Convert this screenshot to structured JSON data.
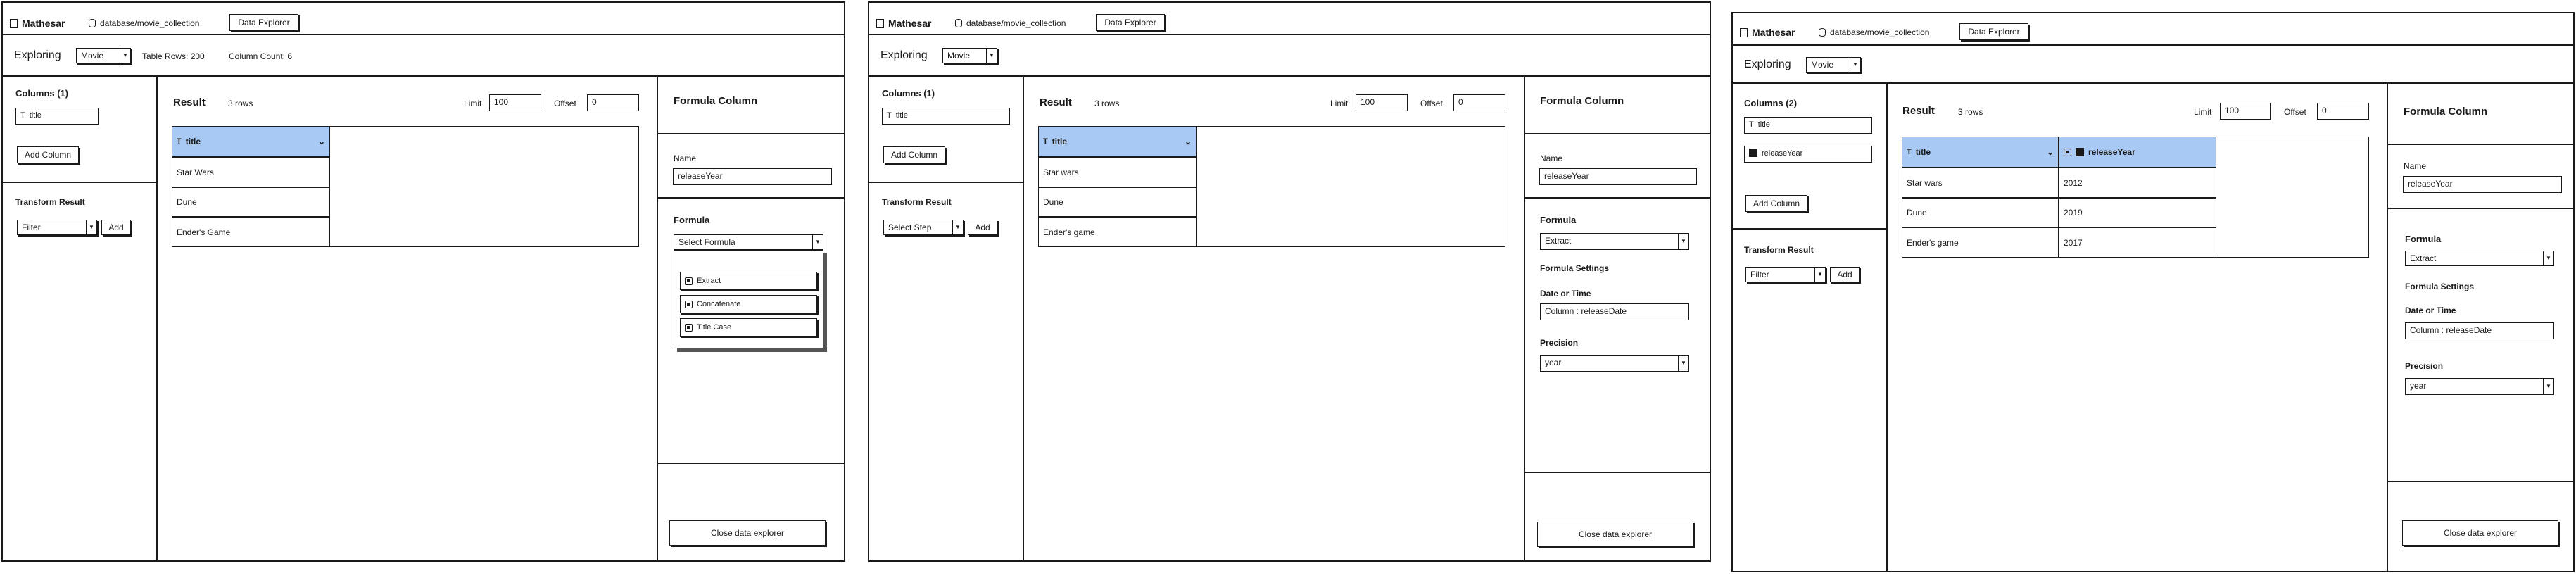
{
  "frames": [
    {
      "app": {
        "logo": "Mathesar",
        "breadcrumb": "database/movie_collection",
        "tab": "Data Explorer"
      },
      "explore": {
        "label": "Exploring",
        "table": "Movie",
        "table_rows": "Table Rows: 200",
        "column_count": "Column Count: 6"
      },
      "left": {
        "columns_heading": "Columns (1)",
        "columns": [
          "title"
        ],
        "add_column": "Add Column",
        "transform_heading": "Transform Result",
        "transform_select": "Filter",
        "add": "Add"
      },
      "result": {
        "heading": "Result",
        "rows": "3 rows",
        "limit_label": "Limit",
        "limit": "100",
        "offset_label": "Offset",
        "offset": "0",
        "headers": [
          "title"
        ],
        "rows_data": [
          [
            "Star Wars"
          ],
          [
            "Dune"
          ],
          [
            "Ender's Game"
          ]
        ]
      },
      "right": {
        "heading": "Formula Column",
        "name_label": "Name",
        "name_value": "releaseYear",
        "formula_heading": "Formula",
        "formula_select": "Select Formula",
        "menu": [
          "Extract",
          "Concatenate",
          "Title Case"
        ],
        "close": "Close data explorer"
      }
    },
    {
      "app": {
        "logo": "Mathesar",
        "breadcrumb": "database/movie_collection",
        "tab": "Data Explorer"
      },
      "explore": {
        "label": "Exploring",
        "table": "Movie"
      },
      "left": {
        "columns_heading": "Columns (1)",
        "columns": [
          "title"
        ],
        "add_column": "Add Column",
        "transform_heading": "Transform Result",
        "transform_select": "Select Step",
        "add": "Add"
      },
      "result": {
        "heading": "Result",
        "rows": "3 rows",
        "limit_label": "Limit",
        "limit": "100",
        "offset_label": "Offset",
        "offset": "0",
        "headers": [
          "title"
        ],
        "rows_data": [
          [
            "Star wars"
          ],
          [
            "Dune"
          ],
          [
            "Ender's game"
          ]
        ]
      },
      "right": {
        "heading": "Formula Column",
        "name_label": "Name",
        "name_value": "releaseYear",
        "formula_heading": "Formula",
        "formula_select": "Extract",
        "settings_heading": "Formula Settings",
        "date_label": "Date or Time",
        "date_value": "Column : releaseDate",
        "precision_label": "Precision",
        "precision_value": "year",
        "close": "Close data explorer"
      }
    },
    {
      "app": {
        "logo": "Mathesar",
        "breadcrumb": "database/movie_collection",
        "tab": "Data Explorer"
      },
      "explore": {
        "label": "Exploring",
        "table": "Movie"
      },
      "left": {
        "columns_heading": "Columns (2)",
        "columns": [
          "title",
          "releaseYear"
        ],
        "add_column": "Add Column",
        "transform_heading": "Transform Result",
        "transform_select": "Filter",
        "add": "Add"
      },
      "result": {
        "heading": "Result",
        "rows": "3 rows",
        "limit_label": "Limit",
        "limit": "100",
        "offset_label": "Offset",
        "offset": "0",
        "headers": [
          "title",
          "releaseYear"
        ],
        "rows_data": [
          [
            "Star wars",
            "2012"
          ],
          [
            "Dune",
            "2019"
          ],
          [
            "Ender's game",
            "2017"
          ]
        ]
      },
      "right": {
        "heading": "Formula Column",
        "name_label": "Name",
        "name_value": "releaseYear",
        "formula_heading": "Formula",
        "formula_select": "Extract",
        "settings_heading": "Formula Settings",
        "date_label": "Date or Time",
        "date_value": "Column : releaseDate",
        "precision_label": "Precision",
        "precision_value": "year",
        "close": "Close data explorer"
      }
    }
  ]
}
